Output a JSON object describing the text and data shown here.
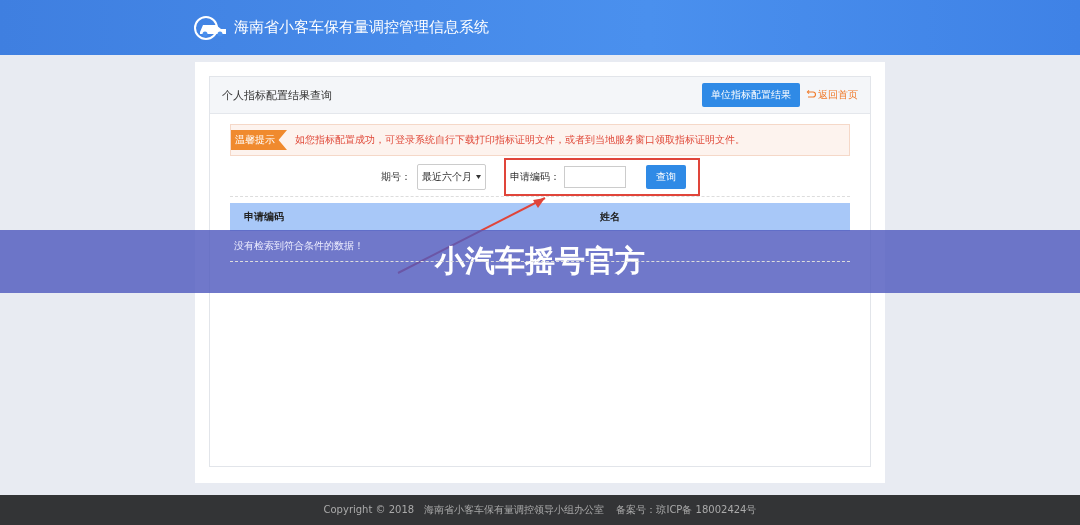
{
  "header": {
    "title": "海南省小客车保有量调控管理信息系统"
  },
  "panel": {
    "title": "个人指标配置结果查询",
    "unit_button": "单位指标配置结果",
    "back_link": "返回首页"
  },
  "notice": {
    "badge": "温馨提示",
    "text": "如您指标配置成功，可登录系统自行下载打印指标证明文件，或者到当地服务窗口领取指标证明文件。"
  },
  "filters": {
    "period_label": "期号：",
    "period_value": "最近六个月",
    "code_label": "申请编码：",
    "search_button": "查询"
  },
  "table": {
    "columns": [
      "申请编码",
      "姓名"
    ],
    "empty_message": "没有检索到符合条件的数据！"
  },
  "overlay": {
    "caption": "小汽车摇号官方"
  },
  "footer": {
    "text": "Copyright © 2018   海南省小客车保有量调控领导小组办公室    备案号：琼ICP备 18002424号"
  }
}
